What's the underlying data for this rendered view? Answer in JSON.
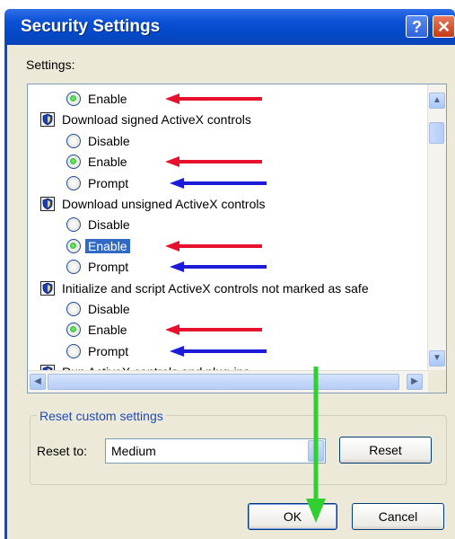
{
  "window": {
    "title": "Security Settings",
    "help_label": "?",
    "close_label": "✕"
  },
  "settings_label": "Settings:",
  "tree": [
    {
      "kind": "option",
      "label": "Enable",
      "checked": true,
      "selected": false,
      "arrow": "red"
    },
    {
      "kind": "category",
      "label": "Download signed ActiveX controls"
    },
    {
      "kind": "option",
      "label": "Disable",
      "checked": false,
      "selected": false,
      "arrow": null
    },
    {
      "kind": "option",
      "label": "Enable",
      "checked": true,
      "selected": false,
      "arrow": "red"
    },
    {
      "kind": "option",
      "label": "Prompt",
      "checked": false,
      "selected": false,
      "arrow": "blue"
    },
    {
      "kind": "category",
      "label": "Download unsigned ActiveX controls"
    },
    {
      "kind": "option",
      "label": "Disable",
      "checked": false,
      "selected": false,
      "arrow": null
    },
    {
      "kind": "option",
      "label": "Enable",
      "checked": true,
      "selected": true,
      "arrow": "red"
    },
    {
      "kind": "option",
      "label": "Prompt",
      "checked": false,
      "selected": false,
      "arrow": "blue"
    },
    {
      "kind": "category",
      "label": "Initialize and script ActiveX controls not marked as safe"
    },
    {
      "kind": "option",
      "label": "Disable",
      "checked": false,
      "selected": false,
      "arrow": null
    },
    {
      "kind": "option",
      "label": "Enable",
      "checked": true,
      "selected": false,
      "arrow": "red"
    },
    {
      "kind": "option",
      "label": "Prompt",
      "checked": false,
      "selected": false,
      "arrow": "blue"
    },
    {
      "kind": "category",
      "label": "Run ActiveX controls and plug-ins"
    }
  ],
  "reset_group": {
    "legend": "Reset custom settings",
    "reset_to_label": "Reset to:",
    "selected_level": "Medium",
    "reset_button": "Reset"
  },
  "buttons": {
    "ok": "OK",
    "cancel": "Cancel"
  },
  "colors": {
    "title_bar": "#0a51d6",
    "selection": "#316ac5",
    "arrow_red": "#e8112d",
    "arrow_blue": "#1b1bd8",
    "arrow_green": "#2fd02f"
  },
  "icons": {
    "category": "shield-icon",
    "scroll_up": "scroll-up-arrow-icon",
    "scroll_down": "scroll-down-arrow-icon",
    "scroll_left": "scroll-left-arrow-icon",
    "scroll_right": "scroll-right-arrow-icon",
    "dropdown": "chevron-down-icon"
  }
}
